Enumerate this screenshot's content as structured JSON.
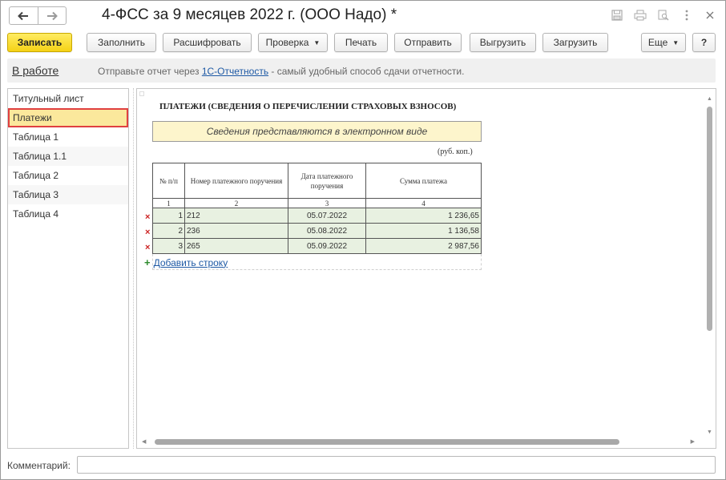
{
  "window": {
    "title": "4-ФСС за 9 месяцев 2022 г. (ООО Надо) *",
    "back_icon": "arrow-left-icon",
    "forward_icon": "arrow-right-icon"
  },
  "toolbar": {
    "save": "Записать",
    "fill": "Заполнить",
    "decode": "Расшифровать",
    "check": "Проверка",
    "print": "Печать",
    "send": "Отправить",
    "export": "Выгрузить",
    "import": "Загрузить",
    "more": "Еще",
    "help": "?"
  },
  "status": {
    "state": "В работе",
    "hint_before": "Отправьте отчет через ",
    "hint_link": "1С-Отчетность",
    "hint_after": " - самый удобный способ сдачи отчетности."
  },
  "sections": [
    {
      "label": "Титульный лист"
    },
    {
      "label": "Платежи"
    },
    {
      "label": "Таблица 1"
    },
    {
      "label": "Таблица 1.1"
    },
    {
      "label": "Таблица 2"
    },
    {
      "label": "Таблица 3"
    },
    {
      "label": "Таблица 4"
    }
  ],
  "selected_section": "Платежи",
  "document": {
    "heading": "ПЛАТЕЖИ (СВЕДЕНИЯ О ПЕРЕЧИСЛЕНИИ СТРАХОВЫХ ВЗНОСОВ)",
    "notice": "Сведения представляются в электронном виде",
    "units": "(руб. коп.)",
    "columns": [
      "№ п/п",
      "Номер платежного поручения",
      "Дата платежного поручения",
      "Сумма платежа"
    ],
    "column_numbers": [
      "1",
      "2",
      "3",
      "4"
    ],
    "rows": [
      {
        "n": "1",
        "order": "212",
        "date": "05.07.2022",
        "amount": "1 236,65"
      },
      {
        "n": "2",
        "order": "236",
        "date": "05.08.2022",
        "amount": "1 136,58"
      },
      {
        "n": "3",
        "order": "265",
        "date": "05.09.2022",
        "amount": "2 987,56"
      }
    ],
    "add_row": "Добавить строку"
  },
  "comment": {
    "label": "Комментарий:",
    "value": ""
  },
  "colors": {
    "primary_button": "#f5d216",
    "row_fill": "#e8f1e1",
    "notice_fill": "#fdf5cc",
    "selection_fill": "#fbe89c",
    "selection_border": "#e04040",
    "link": "#1f5aa5"
  }
}
